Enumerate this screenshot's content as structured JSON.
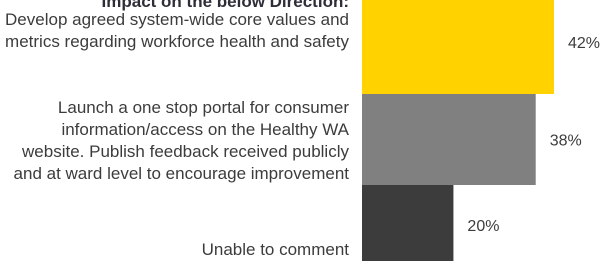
{
  "heading": "Impact on the below Direction:",
  "chart_data": {
    "type": "bar",
    "orientation": "horizontal",
    "categories": [
      "Develop agreed system-wide core values and metrics regarding workforce health and safety",
      "Launch a one stop portal for consumer information/access on the Healthy WA website. Publish feedback received publicly and at ward level to encourage improvement",
      "Unable to comment"
    ],
    "values": [
      42,
      38,
      20
    ],
    "value_labels": [
      "42%",
      "38%",
      "20%"
    ],
    "colors": [
      "#ffd200",
      "#808080",
      "#3c3c3c"
    ],
    "xlim": [
      0,
      42
    ]
  }
}
